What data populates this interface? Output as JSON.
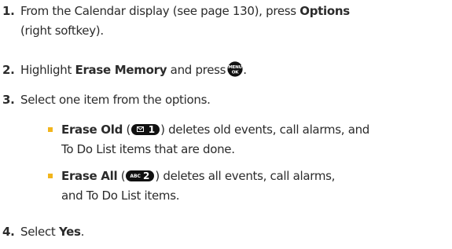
{
  "steps": [
    {
      "number": "1.",
      "line1_prefix": "From the Calendar display (see page 130), press ",
      "line1_bold": "Options",
      "line2": "(right softkey)."
    },
    {
      "number": "2.",
      "prefix": "Highlight ",
      "bold": "Erase Memory",
      "suffix": " and press",
      "button_icon": "menu-ok-icon",
      "button_top": "MENU",
      "button_bottom": "OK",
      "end": "."
    },
    {
      "number": "3.",
      "text": "Select one item from the options."
    },
    {
      "number": "4.",
      "prefix": "Select ",
      "bold": "Yes",
      "suffix": "."
    }
  ],
  "options": [
    {
      "bold": "Erase Old",
      "open": " (",
      "key_icon": "envelope-key-1-icon",
      "key_label": "1",
      "close_line1": ") deletes old events, call alarms, and",
      "line2": "To Do List items that are done."
    },
    {
      "bold": "Erase All",
      "open": " (",
      "key_icon": "abc-key-2-icon",
      "key_abc": "ABC",
      "key_label": "2",
      "close_line1": ") deletes all events, call alarms,",
      "line2": "and To Do List items."
    }
  ],
  "colors": {
    "text": "#2b2b2b",
    "bullet": "#f2b51c",
    "key": "#111111"
  }
}
